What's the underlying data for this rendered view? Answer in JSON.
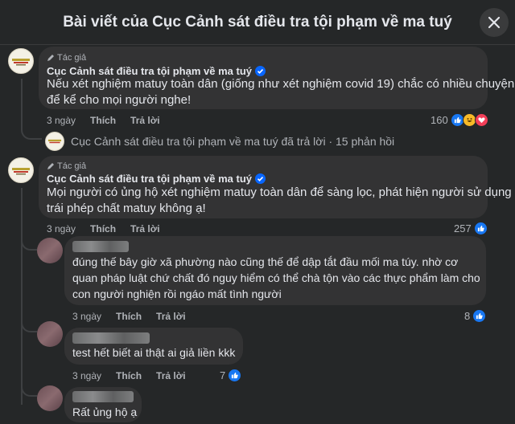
{
  "header": {
    "title": "Bài viết của Cục Cảnh sát điều tra tội phạm về ma tuý"
  },
  "comments": [
    {
      "badge": "Tác giả",
      "author": "Cục Cảnh sát điều tra tội phạm về ma tuý",
      "line1": "Nếu xét nghiệm matuy toàn dân (giống như xét nghiệm covid 19) chắc có nhiều chuyện",
      "line2": "để kể cho mọi người nghe!",
      "time": "3 ngày",
      "like": "Thích",
      "reply": "Trả lời",
      "reaction_count": "160"
    },
    {
      "badge": "Tác giả",
      "author": "Cục Cảnh sát điều tra tội phạm về ma tuý",
      "line1": "Mọi người có ủng hộ xét nghiệm matuy toàn dân để sàng lọc, phát hiện người sử dụng",
      "line2": "trái phép chất matuy không ạ!",
      "time": "3 ngày",
      "like": "Thích",
      "reply": "Trả lời",
      "reaction_count": "257"
    }
  ],
  "reply_summary": "Cục Cảnh sát điều tra tội phạm về ma tuý đã trả lời · 15 phản hồi",
  "replies": [
    {
      "line1": "đúng thế bây giờ xã phường nào cũng thế để dập tắt đầu mối ma túy. nhờ cơ",
      "line2": "quan pháp luật chứ chất đó nguy hiểm có thể chà tộn vào các thực phẩm làm cho",
      "line3": "con người nghiện rồi ngáo mất tình người",
      "time": "3 ngày",
      "like": "Thích",
      "reply": "Trả lời",
      "reaction_count": "8"
    },
    {
      "line1": "test hết biết ai thật ai giả liền kkk",
      "time": "3 ngày",
      "like": "Thích",
      "reply": "Trả lời",
      "reaction_count": "7"
    },
    {
      "line1": "Rất ủng hộ ạ"
    }
  ],
  "colors": {
    "background": "#252728",
    "bubble": "#333334",
    "accent": "#1877f2",
    "verified": "#0866ff"
  }
}
